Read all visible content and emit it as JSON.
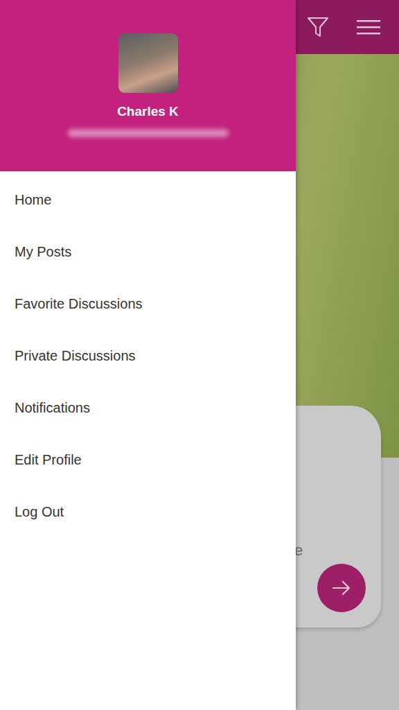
{
  "drawer": {
    "user": {
      "name": "Charles K"
    },
    "menu": [
      {
        "label": "Home"
      },
      {
        "label": "My Posts"
      },
      {
        "label": "Favorite Discussions"
      },
      {
        "label": "Private Discussions"
      },
      {
        "label": "Notifications"
      },
      {
        "label": "Edit Profile"
      },
      {
        "label": "Log Out"
      }
    ]
  },
  "card": {
    "text": "e"
  }
}
